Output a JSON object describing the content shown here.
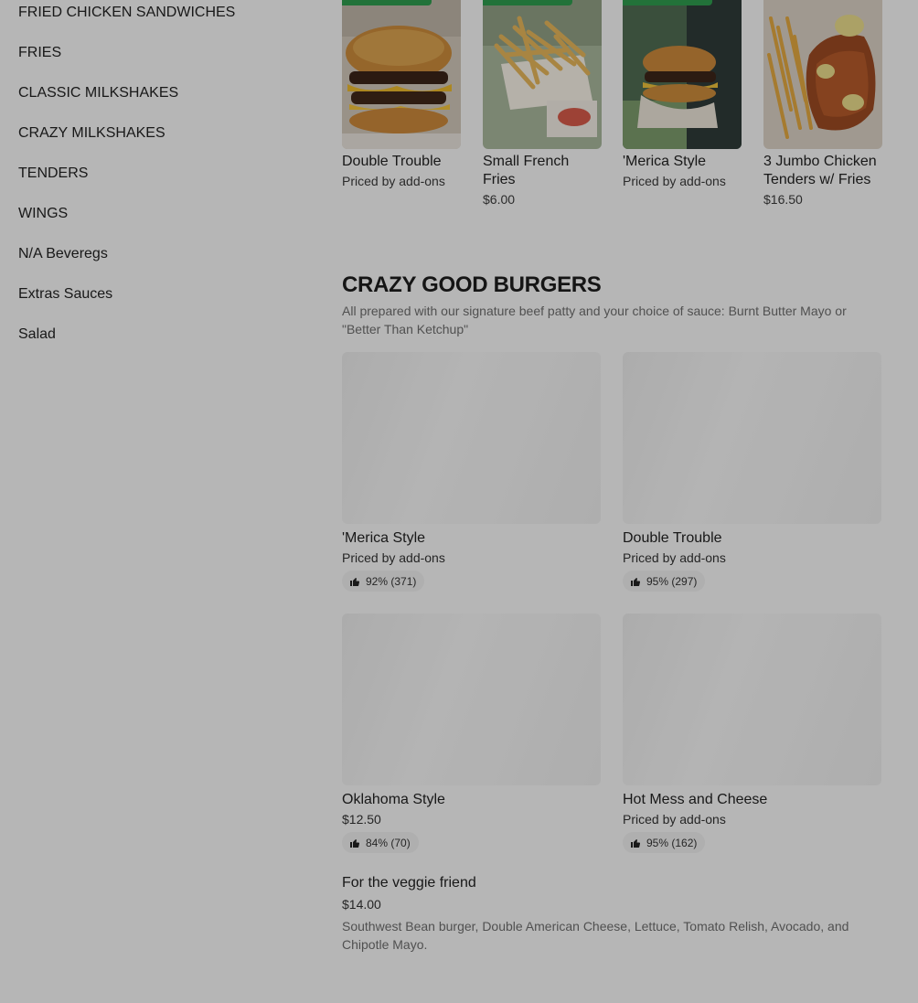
{
  "sidebar": {
    "items": [
      {
        "label": "FRIED CHICKEN SANDWICHES"
      },
      {
        "label": "FRIES"
      },
      {
        "label": "CLASSIC MILKSHAKES"
      },
      {
        "label": "CRAZY MILKSHAKES"
      },
      {
        "label": "TENDERS"
      },
      {
        "label": "WINGS"
      },
      {
        "label": "N/A Beveregs"
      },
      {
        "label": "Extras Sauces"
      },
      {
        "label": "Salad"
      }
    ]
  },
  "featured": {
    "items": [
      {
        "name": "Double Trouble",
        "price": "Priced by add-ons",
        "icon": "burger-photo"
      },
      {
        "name": "Small French Fries",
        "price": "$6.00",
        "icon": "fries-photo"
      },
      {
        "name": "'Merica Style",
        "price": "Priced by add-ons",
        "icon": "burger-photo"
      },
      {
        "name": "3 Jumbo Chicken Tenders w/ Fries",
        "price": "$16.50",
        "icon": "tenders-photo"
      }
    ]
  },
  "section": {
    "title": "CRAZY GOOD BURGERS",
    "description": "All prepared with our signature beef patty and your choice of sauce: Burnt Butter Mayo or \"Better Than Ketchup\"",
    "items": [
      {
        "name": "'Merica Style",
        "price": "Priced by add-ons",
        "rating": "92% (371)"
      },
      {
        "name": "Double Trouble",
        "price": "Priced by add-ons",
        "rating": "95% (297)"
      },
      {
        "name": "Oklahoma Style",
        "price": "$12.50",
        "rating": "84% (70)"
      },
      {
        "name": "Hot Mess and Cheese",
        "price": "Priced by add-ons",
        "rating": "95% (162)"
      }
    ],
    "veggie": {
      "name": "For the veggie friend",
      "price": "$14.00",
      "description": "Southwest Bean burger, Double American Cheese, Lettuce, Tomato Relish, Avocado, and Chipotle Mayo."
    }
  },
  "colors": {
    "badge_green": "#2e9a4d",
    "overlay": "rgba(0,0,0,0.26)"
  }
}
